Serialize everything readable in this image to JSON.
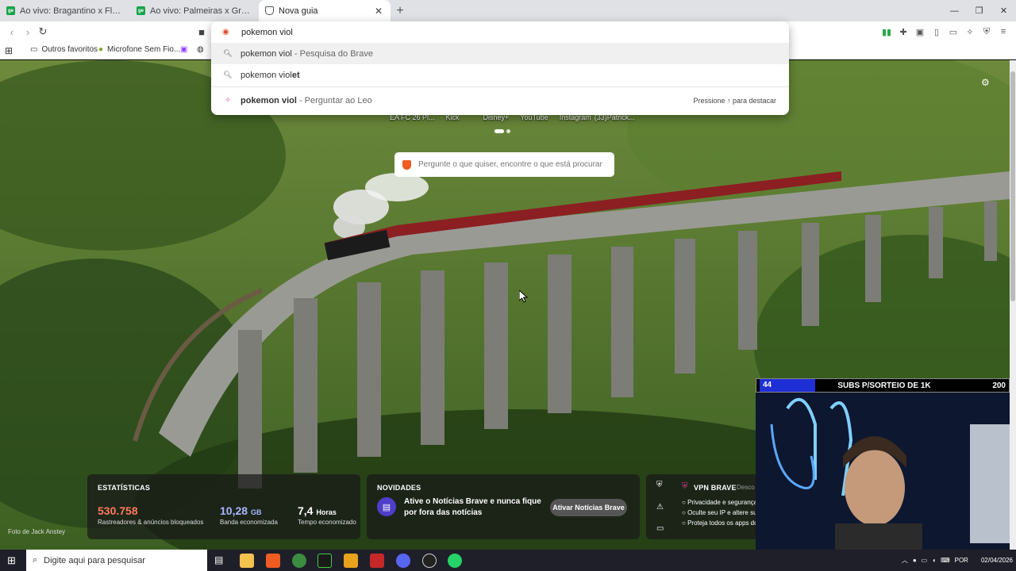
{
  "tabs": [
    {
      "title": "Ao vivo: Bragantino x Flamengo | Ro"
    },
    {
      "title": "Ao vivo: Palmeiras x Grêmio | Rodad"
    },
    {
      "title": "Nova guia"
    }
  ],
  "bookmarks": {
    "folder": "Outros favoritos",
    "item": "Microfone Sem Fio..."
  },
  "omnibox": {
    "query": "pokemon viol",
    "suggestions": [
      {
        "bold": "pokemon viol",
        "rest": " - Pesquisa do Brave"
      },
      {
        "plain": "pokemon viol",
        "bold": "et"
      },
      {
        "bold": "pokemon viol",
        "rest": " - Perguntar ao Leo",
        "hint": "Pressione ↑ para destacar"
      }
    ]
  },
  "top_sites": [
    "EA FC 26 Pl...",
    "Kick",
    "Disney+",
    "YouTube",
    "Instagram",
    "(33)Patrick..."
  ],
  "search": {
    "placeholder": "Pergunte o que quiser, encontre o que está procurar"
  },
  "stats": {
    "title": "ESTATÍSTICAS",
    "trackers": {
      "value": "530.758",
      "label": "Rastreadores & anúncios bloqueados"
    },
    "bandwidth": {
      "value": "10,28",
      "unit": "GB",
      "label": "Banda economizada"
    },
    "time": {
      "value": "7,4",
      "unit": "Horas",
      "label": "Tempo economizado"
    }
  },
  "news": {
    "title": "NOVIDADES",
    "text": "Ative o Notícias Brave e nunca fique por fora das notícias",
    "button": "Ativar Notícias Brave"
  },
  "vpn": {
    "title": "VPN BRAVE",
    "status": "Desco",
    "items": [
      "Privacidade e segurança",
      "Oculte seu IP e altere sua",
      "Proteja todos os apps do"
    ]
  },
  "photo_credit": "Foto de Jack Anstey",
  "stream": {
    "left": "44",
    "center": "SUBS P/SORTEIO DE 1K",
    "right": "200"
  },
  "taskbar": {
    "search_placeholder": "Digite aqui para pesquisar",
    "lang": "POR",
    "date": "02/04/2026"
  },
  "colors": {
    "accent": "#f05b22",
    "trackers": "#ff7a5c"
  }
}
